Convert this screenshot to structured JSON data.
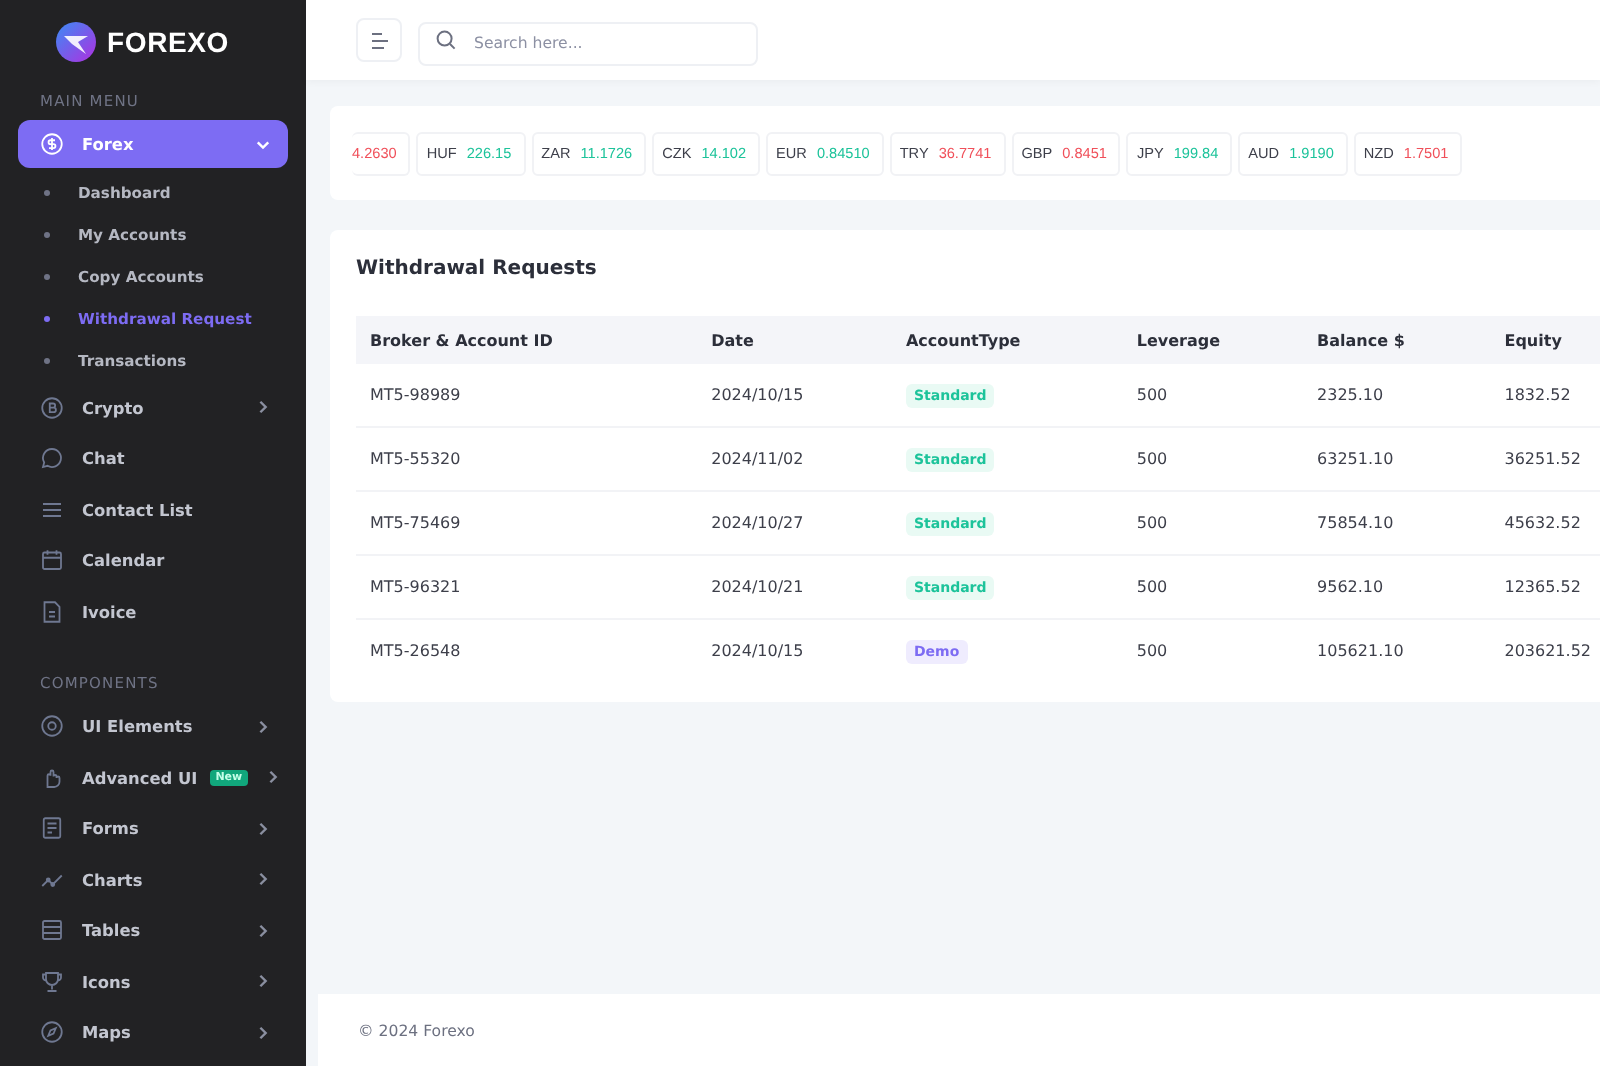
{
  "brand": {
    "name": "FOREXO"
  },
  "sidebar": {
    "sections": [
      {
        "title": "MAIN MENU",
        "items": [
          {
            "label": "Forex",
            "kind": "menu",
            "expanded": true,
            "selected": true,
            "children": [
              {
                "label": "Dashboard",
                "selected": false
              },
              {
                "label": "My Accounts",
                "selected": false
              },
              {
                "label": "Copy Accounts",
                "selected": false
              },
              {
                "label": "Withdrawal Request",
                "selected": true
              },
              {
                "label": "Transactions",
                "selected": false
              }
            ]
          },
          {
            "label": "Crypto",
            "kind": "menu",
            "expanded": false,
            "selected": false
          },
          {
            "label": "Chat",
            "kind": "link",
            "selected": false
          },
          {
            "label": "Contact List",
            "kind": "link",
            "selected": false
          },
          {
            "label": "Calendar",
            "kind": "link",
            "selected": false
          },
          {
            "label": "Ivoice",
            "kind": "link",
            "selected": false
          }
        ]
      },
      {
        "title": "COMPONENTS",
        "items": [
          {
            "label": "UI Elements",
            "kind": "menu",
            "expanded": false,
            "selected": false
          },
          {
            "label": "Advanced UI",
            "kind": "menu",
            "expanded": false,
            "selected": false,
            "badge": "New"
          },
          {
            "label": "Forms",
            "kind": "menu",
            "expanded": false,
            "selected": false
          },
          {
            "label": "Charts",
            "kind": "menu",
            "expanded": false,
            "selected": false
          },
          {
            "label": "Tables",
            "kind": "menu",
            "expanded": false,
            "selected": false
          },
          {
            "label": "Icons",
            "kind": "menu",
            "expanded": false,
            "selected": false
          },
          {
            "label": "Maps",
            "kind": "menu",
            "expanded": false,
            "selected": false
          }
        ]
      }
    ]
  },
  "search": {
    "placeholder": "Search here..."
  },
  "ticker": [
    {
      "value": "4.2630",
      "color": "#f0505a"
    },
    {
      "currency": "HUF",
      "value": "226.15",
      "color": "#1cc39a"
    },
    {
      "currency": "ZAR",
      "value": "11.1726",
      "color": "#1cc39a"
    },
    {
      "currency": "CZK",
      "value": "14.102",
      "color": "#1cc39a"
    },
    {
      "currency": "EUR",
      "value": "0.84510",
      "color": "#1cc39a"
    },
    {
      "currency": "TRY",
      "value": "36.7741",
      "color": "#f0505a"
    },
    {
      "currency": "GBP",
      "value": "0.8451",
      "color": "#f0505a"
    },
    {
      "currency": "JPY",
      "value": "199.84",
      "color": "#1cc39a"
    },
    {
      "currency": "AUD",
      "value": "1.9190",
      "color": "#1cc39a"
    },
    {
      "currency": "NZD",
      "value": "1.7501",
      "color": "#f0505a"
    }
  ],
  "table": {
    "title": "Withdrawal Requests",
    "columns": [
      "Broker & Account ID",
      "Date",
      "AccountType",
      "Leverage",
      "Balance $",
      "Equity"
    ],
    "rows": [
      {
        "account": "MT5-98989",
        "date": "2024/10/15",
        "type": {
          "label": "Standard",
          "kind": "standard"
        },
        "leverage": "500",
        "balance": "2325.10",
        "equity": "1832.52"
      },
      {
        "account": "MT5-55320",
        "date": "2024/11/02",
        "type": {
          "label": "Standard",
          "kind": "standard"
        },
        "leverage": "500",
        "balance": "63251.10",
        "equity": "36251.52"
      },
      {
        "account": "MT5-75469",
        "date": "2024/10/27",
        "type": {
          "label": "Standard",
          "kind": "standard"
        },
        "leverage": "500",
        "balance": "75854.10",
        "equity": "45632.52"
      },
      {
        "account": "MT5-96321",
        "date": "2024/10/21",
        "type": {
          "label": "Standard",
          "kind": "standard"
        },
        "leverage": "500",
        "balance": "9562.10",
        "equity": "12365.52"
      },
      {
        "account": "MT5-26548",
        "date": "2024/10/15",
        "type": {
          "label": "Demo",
          "kind": "demo"
        },
        "leverage": "500",
        "balance": "105621.10",
        "equity": "203621.52"
      }
    ]
  },
  "footer": {
    "text": "© 2024 Forexo"
  }
}
